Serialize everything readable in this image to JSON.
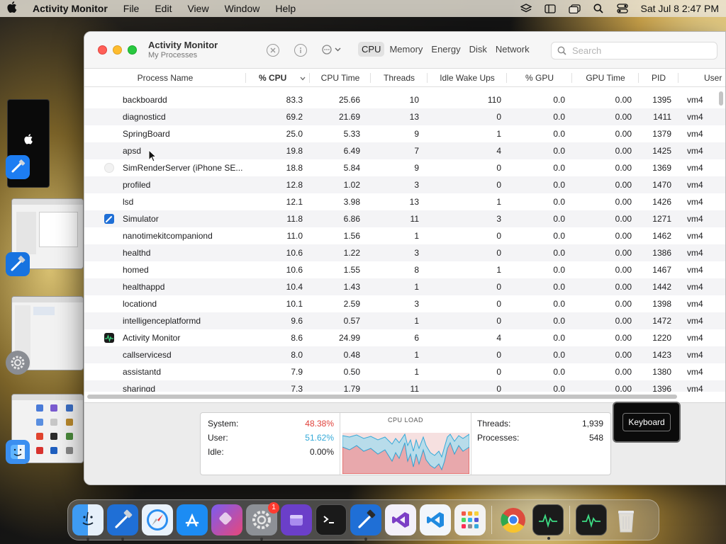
{
  "menubar": {
    "app_name": "Activity Monitor",
    "menus": [
      "File",
      "Edit",
      "View",
      "Window",
      "Help"
    ],
    "datetime": "Sat Jul 8  2:47 PM"
  },
  "window": {
    "title": "Activity Monitor",
    "subtitle": "My Processes",
    "tabs": [
      "CPU",
      "Memory",
      "Energy",
      "Disk",
      "Network"
    ],
    "active_tab": "CPU",
    "search_placeholder": "Search"
  },
  "table": {
    "columns": [
      "Process Name",
      "% CPU",
      "CPU Time",
      "Threads",
      "Idle Wake Ups",
      "% GPU",
      "GPU Time",
      "PID",
      "User"
    ],
    "rows": [
      {
        "name": "backboardd",
        "cpu": "83.3",
        "time": "25.66",
        "threads": "10",
        "wake": "110",
        "gpu": "0.0",
        "gtime": "0.00",
        "pid": "1395",
        "user": "vm4",
        "icon": ""
      },
      {
        "name": "diagnosticd",
        "cpu": "69.2",
        "time": "21.69",
        "threads": "13",
        "wake": "0",
        "gpu": "0.0",
        "gtime": "0.00",
        "pid": "1411",
        "user": "vm4",
        "icon": ""
      },
      {
        "name": "SpringBoard",
        "cpu": "25.0",
        "time": "5.33",
        "threads": "9",
        "wake": "1",
        "gpu": "0.0",
        "gtime": "0.00",
        "pid": "1379",
        "user": "vm4",
        "icon": ""
      },
      {
        "name": "apsd",
        "cpu": "19.8",
        "time": "6.49",
        "threads": "7",
        "wake": "4",
        "gpu": "0.0",
        "gtime": "0.00",
        "pid": "1425",
        "user": "vm4",
        "icon": ""
      },
      {
        "name": "SimRenderServer (iPhone SE...",
        "cpu": "18.8",
        "time": "5.84",
        "threads": "9",
        "wake": "0",
        "gpu": "0.0",
        "gtime": "0.00",
        "pid": "1369",
        "user": "vm4",
        "icon": "blank"
      },
      {
        "name": "profiled",
        "cpu": "12.8",
        "time": "1.02",
        "threads": "3",
        "wake": "0",
        "gpu": "0.0",
        "gtime": "0.00",
        "pid": "1470",
        "user": "vm4",
        "icon": ""
      },
      {
        "name": "lsd",
        "cpu": "12.1",
        "time": "3.98",
        "threads": "13",
        "wake": "1",
        "gpu": "0.0",
        "gtime": "0.00",
        "pid": "1426",
        "user": "vm4",
        "icon": ""
      },
      {
        "name": "Simulator",
        "cpu": "11.8",
        "time": "6.86",
        "threads": "11",
        "wake": "3",
        "gpu": "0.0",
        "gtime": "0.00",
        "pid": "1271",
        "user": "vm4",
        "icon": "simulator"
      },
      {
        "name": "nanotimekitcompaniond",
        "cpu": "11.0",
        "time": "1.56",
        "threads": "1",
        "wake": "0",
        "gpu": "0.0",
        "gtime": "0.00",
        "pid": "1462",
        "user": "vm4",
        "icon": ""
      },
      {
        "name": "healthd",
        "cpu": "10.6",
        "time": "1.22",
        "threads": "3",
        "wake": "0",
        "gpu": "0.0",
        "gtime": "0.00",
        "pid": "1386",
        "user": "vm4",
        "icon": ""
      },
      {
        "name": "homed",
        "cpu": "10.6",
        "time": "1.55",
        "threads": "8",
        "wake": "1",
        "gpu": "0.0",
        "gtime": "0.00",
        "pid": "1467",
        "user": "vm4",
        "icon": ""
      },
      {
        "name": "healthappd",
        "cpu": "10.4",
        "time": "1.43",
        "threads": "1",
        "wake": "0",
        "gpu": "0.0",
        "gtime": "0.00",
        "pid": "1442",
        "user": "vm4",
        "icon": ""
      },
      {
        "name": "locationd",
        "cpu": "10.1",
        "time": "2.59",
        "threads": "3",
        "wake": "0",
        "gpu": "0.0",
        "gtime": "0.00",
        "pid": "1398",
        "user": "vm4",
        "icon": ""
      },
      {
        "name": "intelligenceplatformd",
        "cpu": "9.6",
        "time": "0.57",
        "threads": "1",
        "wake": "0",
        "gpu": "0.0",
        "gtime": "0.00",
        "pid": "1472",
        "user": "vm4",
        "icon": ""
      },
      {
        "name": "Activity Monitor",
        "cpu": "8.6",
        "time": "24.99",
        "threads": "6",
        "wake": "4",
        "gpu": "0.0",
        "gtime": "0.00",
        "pid": "1220",
        "user": "vm4",
        "icon": "activity"
      },
      {
        "name": "callservicesd",
        "cpu": "8.0",
        "time": "0.48",
        "threads": "1",
        "wake": "0",
        "gpu": "0.0",
        "gtime": "0.00",
        "pid": "1423",
        "user": "vm4",
        "icon": ""
      },
      {
        "name": "assistantd",
        "cpu": "7.9",
        "time": "0.50",
        "threads": "1",
        "wake": "0",
        "gpu": "0.0",
        "gtime": "0.00",
        "pid": "1380",
        "user": "vm4",
        "icon": ""
      },
      {
        "name": "sharingd",
        "cpu": "7.3",
        "time": "1.79",
        "threads": "11",
        "wake": "0",
        "gpu": "0.0",
        "gtime": "0.00",
        "pid": "1396",
        "user": "vm4",
        "icon": ""
      }
    ]
  },
  "stats": {
    "system_label": "System:",
    "system_value": "48.38%",
    "user_label": "User:",
    "user_value": "51.62%",
    "idle_label": "Idle:",
    "idle_value": "0.00%",
    "cpu_load_label": "CPU LOAD",
    "threads_label": "Threads:",
    "threads_value": "1,939",
    "processes_label": "Processes:",
    "processes_value": "548",
    "system_color": "#e0413a",
    "user_color": "#34a9d8"
  },
  "keyboard_label": "Keyboard",
  "dock": {
    "items": [
      "Finder",
      "Xcode",
      "Safari",
      "App Store",
      "Shortcuts",
      "System Settings",
      "Notes",
      "Terminal",
      "Xcode",
      "Visual Studio",
      "VS Code",
      "Launchpad",
      "Chrome",
      "Activity Monitor",
      "Activity Monitor",
      "Trash"
    ],
    "settings_badge": "1"
  }
}
